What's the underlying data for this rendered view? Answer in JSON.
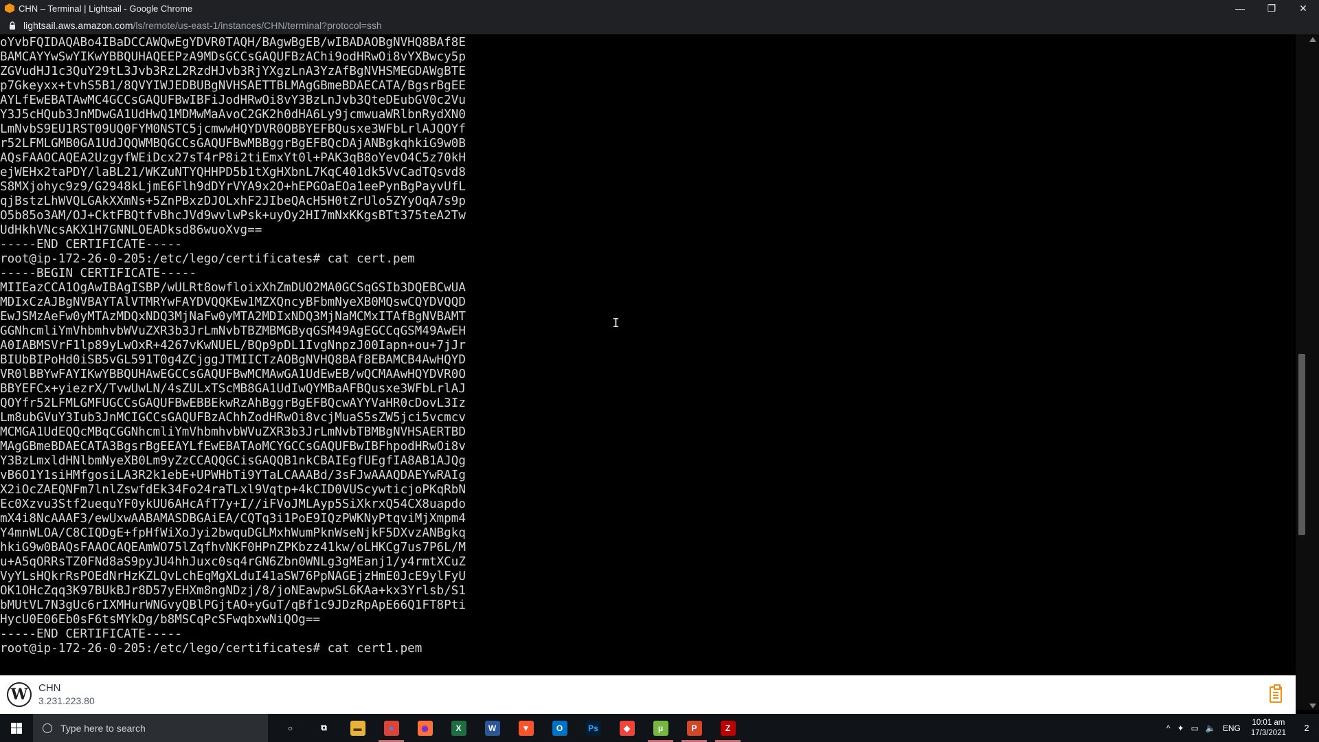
{
  "window": {
    "title": "CHN – Terminal | Lightsail - Google Chrome",
    "app_icon": "aws-lightsail-icon",
    "buttons": {
      "minimize": "—",
      "maximize": "❐",
      "close": "✕"
    }
  },
  "address": {
    "host": "lightsail.aws.amazon.com",
    "path": "/ls/remote/us-east-1/instances/CHN/terminal?protocol=ssh"
  },
  "terminal": {
    "lines": [
      "oYvbFQIDAQABo4IBaDCCAWQwEgYDVR0TAQH/BAgwBgEB/wIBADAOBgNVHQ8BAf8E",
      "BAMCAYYwSwYIKwYBBQUHAQEEPzA9MDsGCCsGAQUFBzAChi9odHRwOi8vYXBwcy5p",
      "ZGVudHJ1c3QuY29tL3Jvb3RzL2RzdHJvb3RjYXgzLnA3YzAfBgNVHSMEGDAWgBTE",
      "p7Gkeyxx+tvhS5B1/8QVYIWJEDBUBgNVHSAETTBLMAgGBmeBDAECATA/BgsrBgEE",
      "AYLfEwEBATAwMC4GCCsGAQUFBwIBFiJodHRwOi8vY3BzLnJvb3QteDEubGV0c2Vu",
      "Y3J5cHQub3JnMDwGA1UdHwQ1MDMwMaAvoC2GK2h0dHA6Ly9jcmwuaWRlbnRydXN0",
      "LmNvbS9EU1RST09UQ0FYM0NSTC5jcmwwHQYDVR0OBBYEFBQusxe3WFbLrlAJQOYf",
      "r52LFMLGMB0GA1UdJQQWMBQGCCsGAQUFBwMBBggrBgEFBQcDAjANBgkqhkiG9w0B",
      "AQsFAAOCAQEA2UzgyfWEiDcx27sT4rP8i2tiEmxYt0l+PAK3qB8oYevO4C5z70kH",
      "ejWEHx2taPDY/laBL21/WKZuNTYQHHPD5b1tXgHXbnL7KqC401dk5VvCadTQsvd8",
      "S8MXjohyc9z9/G2948kLjmE6Flh9dDYrVYA9x2O+hEPGOaEOa1eePynBgPayvUfL",
      "qjBstzLhWVQLGAkXXmNs+5ZnPBxzDJOLxhF2JIbeQAcH5H0tZrUlo5ZYyOqA7s9p",
      "O5b85o3AM/OJ+CktFBQtfvBhcJVd9wvlwPsk+uyOy2HI7mNxKKgsBTt375teA2Tw",
      "UdHkhVNcsAKX1H7GNNLOEADksd86wuoXvg==",
      "-----END CERTIFICATE-----",
      "root@ip-172-26-0-205:/etc/lego/certificates# cat cert.pem",
      "-----BEGIN CERTIFICATE-----",
      "MIIEazCCA1OgAwIBAgISBP/wULRt8owfloixXhZmDUO2MA0GCSqGSIb3DQEBCwUA",
      "MDIxCzAJBgNVBAYTAlVTMRYwFAYDVQQKEw1MZXQncyBFbmNyeXB0MQswCQYDVQQD",
      "EwJSMzAeFw0yMTAzMDQxNDQ3MjNaFw0yMTA2MDIxNDQ3MjNaMCMxITAfBgNVBAMT",
      "GGNhcmliYmVhbmhvbWVuZXR3b3JrLmNvbTBZMBMGByqGSM49AgEGCCqGSM49AwEH",
      "A0IABMSVrF1lp89yLwOxR+4267vKwNUEL/BQp9pDL1IvgNnpzJ00Iapn+ou+7jJr",
      "BIUbBIPoHd0iSB5vGL591T0g4ZCjggJTMIICTzAOBgNVHQ8BAf8EBAMCB4AwHQYD",
      "VR0lBBYwFAYIKwYBBQUHAwEGCCsGAQUFBwMCMAwGA1UdEwEB/wQCMAAwHQYDVR0O",
      "BBYEFCx+yiezrX/TvwUwLN/4sZULxTScMB8GA1UdIwQYMBaAFBQusxe3WFbLrlAJ",
      "QOYfr52LFMLGMFUGCCsGAQUFBwEBBEkwRzAhBggrBgEFBQcwAYYVaHR0cDovL3Iz",
      "Lm8ubGVuY3Iub3JnMCIGCCsGAQUFBzAChhZodHRwOi8vcjMuaS5sZW5jci5vcmcv",
      "MCMGA1UdEQQcMBqCGGNhcmliYmVhbmhvbWVuZXR3b3JrLmNvbTBMBgNVHSAERTBD",
      "MAgGBmeBDAECATA3BgsrBgEEAYLfEwEBATAoMCYGCCsGAQUFBwIBFhpodHRwOi8v",
      "Y3BzLmxldHNlbmNyeXB0Lm9yZzCCAQQGCisGAQQB1nkCBAIEgfUEgfIA8AB1AJQg",
      "vB6O1Y1siHMfgosiLA3R2k1ebE+UPWHbTi9YTaLCAAABd/3sFJwAAAQDAEYwRAIg",
      "X2iOcZAEQNFm7lnlZswfdEk34Fo24raTLxl9Vqtp+4kCID0VUScywticjoPKqRbN",
      "Ec0Xzvu3Stf2uequYF0ykUU6AHcAfT7y+I//iFVoJMLAyp5SiXkrxQ54CX8uapdo",
      "mX4i8NcAAAF3/ewUxwAABAMASDBGAiEA/CQTq3i1PoE9IQzPWKNyPtqviMjXmpm4",
      "Y4mnWLOA/C8CIQDgE+fpHfWiXoJyi2bwquDGLMxhWumPknWseNjkF5DXvzANBgkq",
      "hkiG9w0BAQsFAAOCAQEAmWO75lZqfhvNKF0HPnZPKbzz41kw/oLHKCg7us7P6L/M",
      "u+A5qORRsTZ0FNd8aS9pyJU4hhJuxc0sq4rGN6Zbn0WNLg3gMEanj1/y4rmtXCuZ",
      "VyYLsHQkrRsPOEdNrHzKZLQvLchEqMgXLduI41aSW76PpNAGEjzHmE0JcE9ylFyU",
      "OK1OHcZqq3K97BUkBJr8D57yEHXm8ngNDzj/8/joNEawpwSL6KAa+kx3Yrlsb/S1",
      "bMUtVL7N3gUc6rIXMHurWNGvyQBlPGjtAO+yGuT/qBf1c9JDzRpApE66Q1FT8Pti",
      "HycU0E06Eb0sF6tsMYkDg/b8MSCqPcSFwqbxwNiQOg==",
      "-----END CERTIFICATE-----",
      "root@ip-172-26-0-205:/etc/lego/certificates# cat cert1.pem"
    ]
  },
  "session": {
    "instance_name": "CHN",
    "instance_ip": "3.231.223.80",
    "logo_icon": "wordpress-icon",
    "logo_glyph": "W",
    "clipboard_icon": "clipboard-icon"
  },
  "taskbar": {
    "search_placeholder": "Type here to search",
    "apps": [
      {
        "name": "cortana-icon",
        "glyph": "○",
        "color": "transparent",
        "fg": "#ffffff"
      },
      {
        "name": "task-view-icon",
        "glyph": "⧉",
        "color": "transparent",
        "fg": "#ffffff"
      },
      {
        "name": "file-explorer-icon",
        "glyph": "▬",
        "color": "#e8b33a",
        "fg": "#4a3a00"
      },
      {
        "name": "chrome-icon",
        "glyph": "●",
        "color": "#db4437",
        "fg": "#4285f4",
        "active": true
      },
      {
        "name": "firefox-icon",
        "glyph": "◉",
        "color": "#ff7139",
        "fg": "#6f2bd8"
      },
      {
        "name": "excel-icon",
        "glyph": "X",
        "color": "#1d6f42",
        "fg": "#ffffff"
      },
      {
        "name": "word-icon",
        "glyph": "W",
        "color": "#2b5797",
        "fg": "#ffffff"
      },
      {
        "name": "brave-icon",
        "glyph": "▼",
        "color": "#fb542b",
        "fg": "#ffffff"
      },
      {
        "name": "outlook-icon",
        "glyph": "O",
        "color": "#0072c6",
        "fg": "#ffffff"
      },
      {
        "name": "photoshop-icon",
        "glyph": "Ps",
        "color": "#001e36",
        "fg": "#31a8ff"
      },
      {
        "name": "anydesk-icon",
        "glyph": "◆",
        "color": "#ef443b",
        "fg": "#ffffff"
      },
      {
        "name": "utorrent-icon",
        "glyph": "μ",
        "color": "#76b83f",
        "fg": "#ffffff",
        "active": true
      },
      {
        "name": "powerpoint-icon",
        "glyph": "P",
        "color": "#d24726",
        "fg": "#ffffff",
        "active": true
      },
      {
        "name": "filezilla-icon",
        "glyph": "Z",
        "color": "#bf0000",
        "fg": "#ffffff",
        "active": true
      }
    ],
    "tray": {
      "chevron": "^",
      "dropbox": "✦",
      "network": "▭",
      "volume": "🔈",
      "language": "ENG",
      "time": "10:01 am",
      "date": "17/3/2021",
      "notifications": "2"
    }
  },
  "colors": {
    "titlebar_bg": "#202124",
    "terminal_bg": "#000000",
    "terminal_fg": "#d8d8d8",
    "accent": "#f29111",
    "taskbar_bg": "#101418"
  }
}
